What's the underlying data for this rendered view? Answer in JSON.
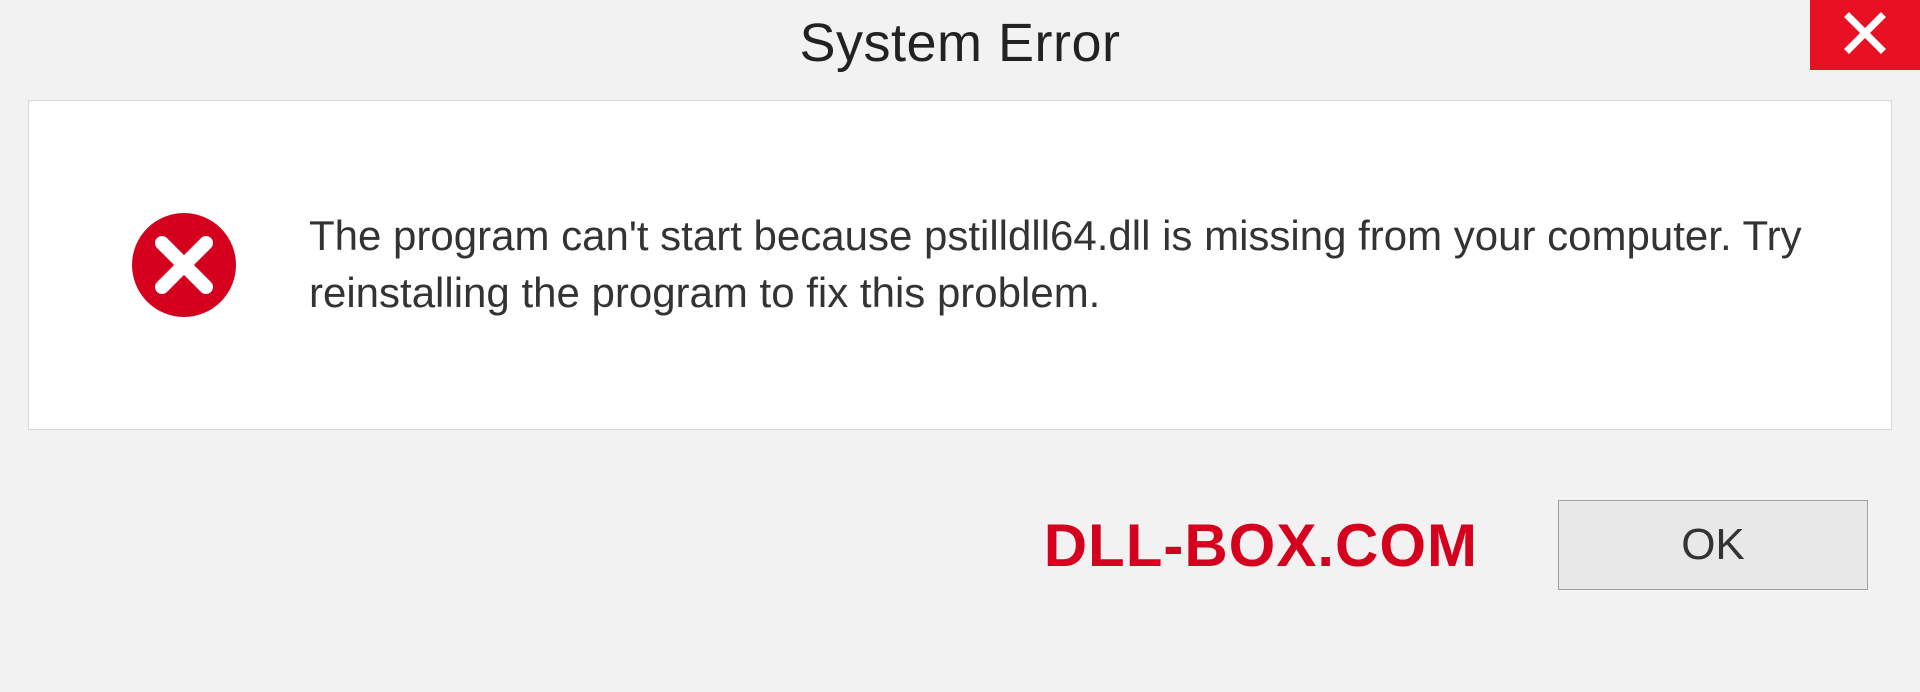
{
  "titlebar": {
    "title": "System Error"
  },
  "dialog": {
    "message": "The program can't start because pstilldll64.dll is missing from your computer. Try reinstalling the program to fix this problem."
  },
  "footer": {
    "watermark": "DLL-BOX.COM",
    "ok_label": "OK"
  },
  "colors": {
    "close_bg": "#e81123",
    "error_icon": "#d4001e",
    "watermark": "#d4001e"
  }
}
